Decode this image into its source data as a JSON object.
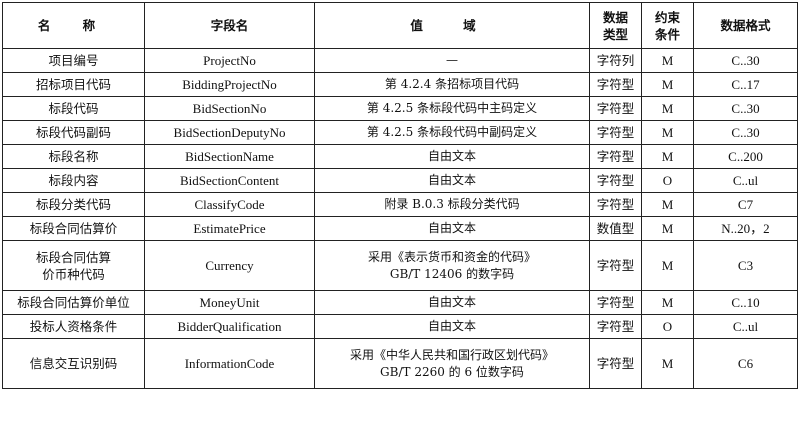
{
  "table": {
    "headers": {
      "name": "名  称",
      "field": "字段名",
      "range": "值  域",
      "type_line1": "数据",
      "type_line2": "类型",
      "constraint_line1": "约束",
      "constraint_line2": "条件",
      "format": "数据格式"
    },
    "rows": [
      {
        "name": "项目编号",
        "field": "ProjectNo",
        "range": "—",
        "range2": "",
        "type": "字符列",
        "constraint": "M",
        "format": "C..30"
      },
      {
        "name": "招标项目代码",
        "field": "BiddingProjectNo",
        "range": "第 4.2.4 条招标项目代码",
        "range2": "",
        "type": "字符型",
        "constraint": "M",
        "format": "C..17"
      },
      {
        "name": "标段代码",
        "field": "BidSectionNo",
        "range": "第 4.2.5 条标段代码中主码定义",
        "range2": "",
        "type": "字符型",
        "constraint": "M",
        "format": "C..30"
      },
      {
        "name": "标段代码副码",
        "field": "BidSectionDeputyNo",
        "range": "第 4.2.5 条标段代码中副码定义",
        "range2": "",
        "type": "字符型",
        "constraint": "M",
        "format": "C..30"
      },
      {
        "name": "标段名称",
        "field": "BidSectionName",
        "range": "自由文本",
        "range2": "",
        "type": "字符型",
        "constraint": "M",
        "format": "C..200"
      },
      {
        "name": "标段内容",
        "field": "BidSectionContent",
        "range": "自由文本",
        "range2": "",
        "type": "字符型",
        "constraint": "O",
        "format": "C..ul"
      },
      {
        "name": "标段分类代码",
        "field": "ClassifyCode",
        "range": "附录 B.0.3 标段分类代码",
        "range2": "",
        "type": "字符型",
        "constraint": "M",
        "format": "C7"
      },
      {
        "name": "标段合同估算价",
        "field": "EstimatePrice",
        "range": "自由文本",
        "range2": "",
        "type": "数值型",
        "constraint": "M",
        "format": "N..20，2"
      },
      {
        "name": "标段合同估算",
        "name2": "价币种代码",
        "field": "Currency",
        "range": "采用《表示货币和资金的代码》",
        "range2": "GB/T 12406 的数字码",
        "type": "字符型",
        "constraint": "M",
        "format": "C3"
      },
      {
        "name": "标段合同估算价单位",
        "field": "MoneyUnit",
        "range": "自由文本",
        "range2": "",
        "type": "字符型",
        "constraint": "M",
        "format": "C..10"
      },
      {
        "name": "投标人资格条件",
        "field": "BidderQualification",
        "range": "自由文本",
        "range2": "",
        "type": "字符型",
        "constraint": "O",
        "format": "C..ul"
      },
      {
        "name": "信息交互识别码",
        "field": "InformationCode",
        "range": "采用《中华人民共和国行政区划代码》",
        "range2": "GB/T 2260 的 6 位数字码",
        "type": "字符型",
        "constraint": "M",
        "format": "C6"
      }
    ]
  }
}
